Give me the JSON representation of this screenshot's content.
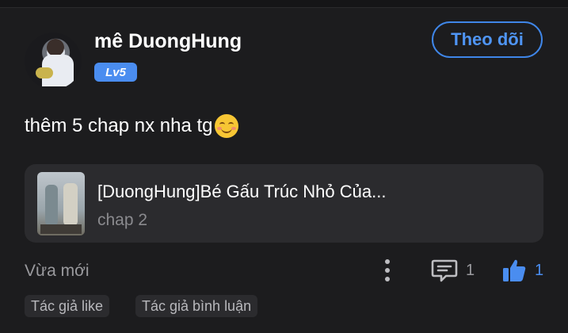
{
  "post": {
    "username": "mê DuongHung",
    "level": "Lv5",
    "follow_label": "Theo dõi",
    "content": "thêm 5 chap nx nha tg",
    "emoji": "smiling-face"
  },
  "linked_work": {
    "title": "[DuongHung]Bé Gấu Trúc Nhỏ Của...",
    "chapter": "chap 2"
  },
  "footer": {
    "time": "Vừa mới",
    "comment_count": "1",
    "like_count": "1"
  },
  "tags": [
    "Tác giả like",
    "Tác giả bình luận"
  ],
  "colors": {
    "background": "#1c1c1e",
    "accent": "#4a8df0",
    "card": "#2b2b2e",
    "muted_text": "#9a9a9e"
  }
}
